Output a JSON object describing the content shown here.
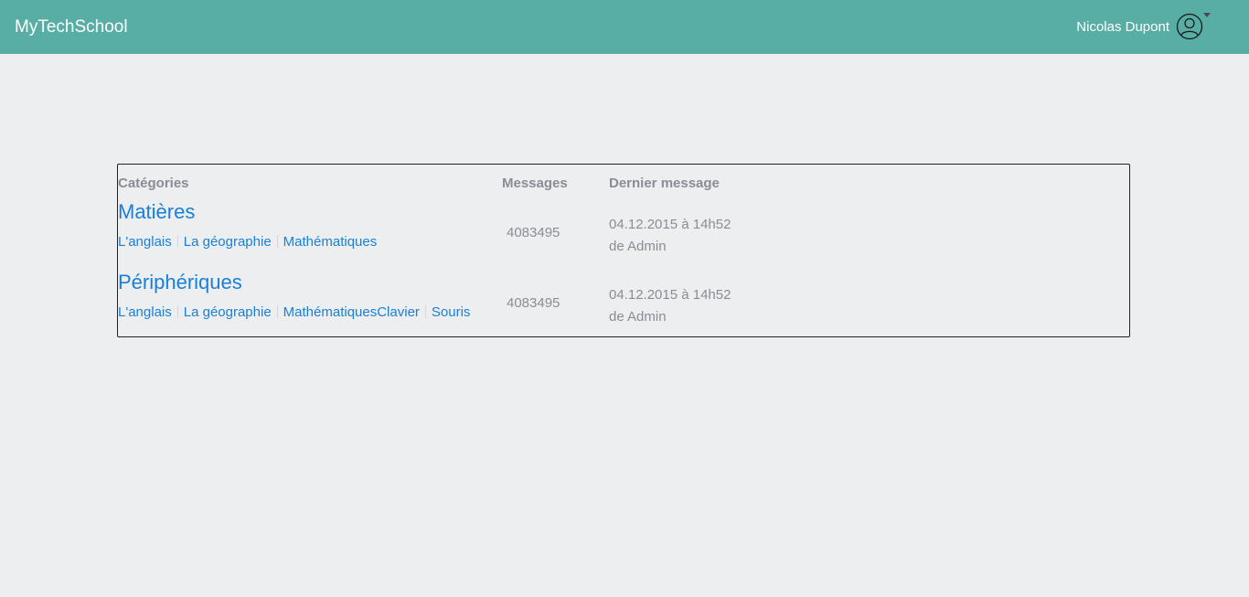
{
  "navbar": {
    "brand": "MyTechSchool",
    "user_name": "Nicolas Dupont"
  },
  "table": {
    "headers": {
      "categories": "Catégories",
      "messages": "Messages",
      "last_message": "Dernier message"
    },
    "rows": [
      {
        "title": "Matières",
        "subcategories": [
          "L'anglais",
          "La géographie",
          "Mathématiques"
        ],
        "messages": "4083495",
        "last_date": "04.12.2015 à 14h52",
        "last_author": "de Admin"
      },
      {
        "title": "Périphériques",
        "subcategories": [
          "L'anglais",
          "La géographie",
          "MathématiquesClavier",
          "Souris"
        ],
        "messages": "4083495",
        "last_date": "04.12.2015 à 14h52",
        "last_author": "de Admin"
      }
    ]
  },
  "colors": {
    "navbar_bg": "#58ada5",
    "page_bg": "#edeef0",
    "link": "#1a7fd6",
    "muted_text": "#8a8d96"
  }
}
